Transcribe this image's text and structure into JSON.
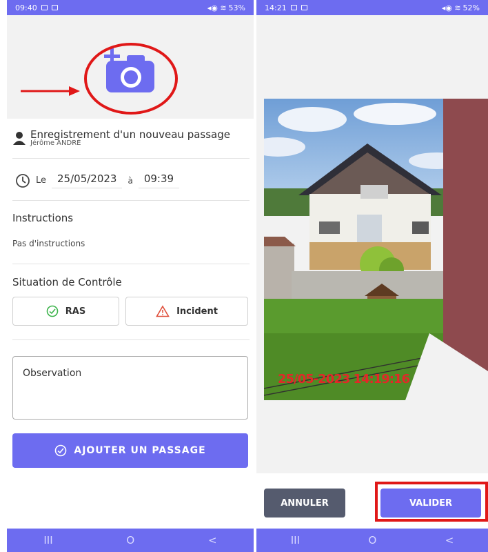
{
  "left_screen": {
    "status": {
      "time": "09:40",
      "right": "53%"
    },
    "header_title": "Enregistrement d'un nouveau passage",
    "user_name": "Jérôme ANDRÉ",
    "date_prefix": "Le",
    "date_value": "25/05/2023",
    "time_sep": "à",
    "time_value": "09:39",
    "instructions_label": "Instructions",
    "instructions_value": "Pas d'instructions",
    "situation_label": "Situation de Contrôle",
    "ras_label": "RAS",
    "incident_label": "Incident",
    "observation_placeholder": "Observation",
    "submit_label": "AJOUTER UN PASSAGE",
    "nav": [
      "III",
      "O",
      "<"
    ]
  },
  "right_screen": {
    "status": {
      "time": "14:21",
      "right": "52%"
    },
    "photo_timestamp": "25/05-2023 14:19:16",
    "cancel_label": "ANNULER",
    "confirm_label": "VALIDER",
    "nav": [
      "III",
      "O",
      "<"
    ]
  },
  "colors": {
    "accent": "#6d6cf0",
    "annotation_red": "#e01818",
    "ras_green": "#3bb34a",
    "incident_red": "#e0503c"
  },
  "icons": [
    "camera-add-icon",
    "user-icon",
    "clock-icon",
    "check-circle-icon",
    "warning-triangle-icon"
  ]
}
